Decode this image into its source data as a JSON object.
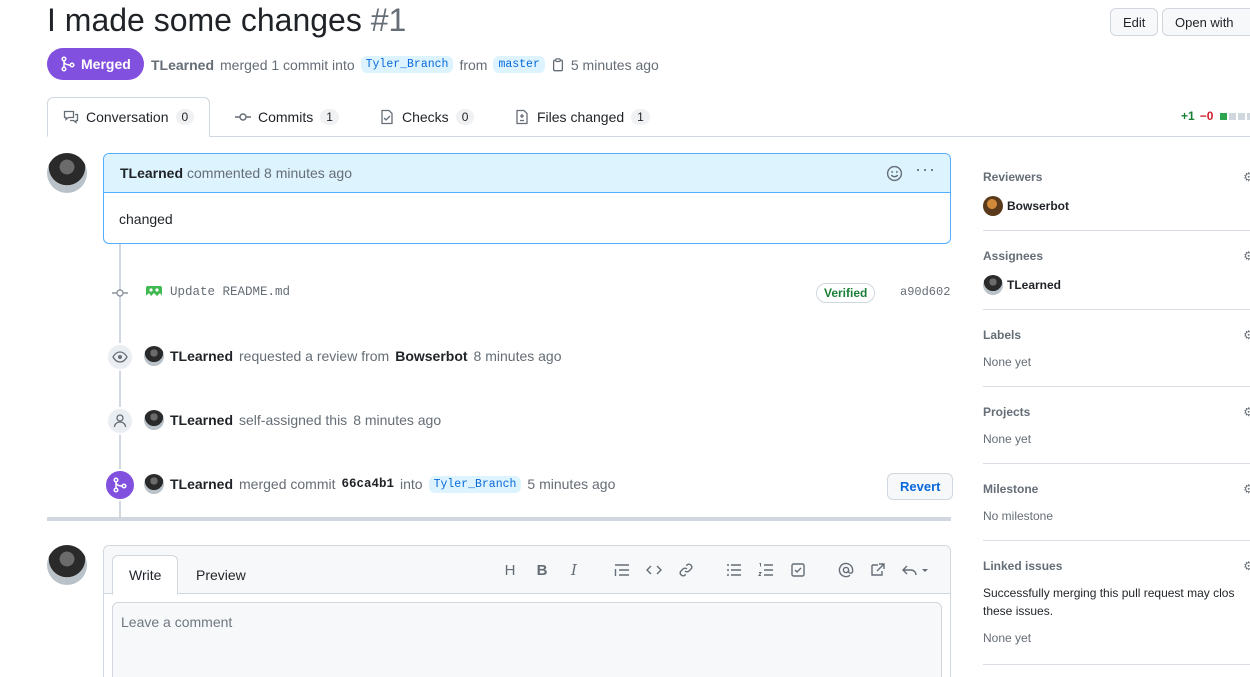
{
  "header": {
    "title": "I made some changes",
    "number": "#1",
    "edit_label": "Edit",
    "open_with_label": "Open with"
  },
  "state": {
    "label": "Merged",
    "author": "TLearned",
    "text_merged": "merged 1 commit into",
    "base_branch": "Tyler_Branch",
    "text_from": "from",
    "head_branch": "master",
    "time": "5 minutes ago"
  },
  "tabs": [
    {
      "label": "Conversation",
      "count": "0"
    },
    {
      "label": "Commits",
      "count": "1"
    },
    {
      "label": "Checks",
      "count": "0"
    },
    {
      "label": "Files changed",
      "count": "1"
    }
  ],
  "diffstat": {
    "additions": "+1",
    "deletions": "−0"
  },
  "comment": {
    "author": "TLearned",
    "meta": "commented 8 minutes ago",
    "body": "changed"
  },
  "timeline": {
    "commit_message": "Update README.md",
    "verified_label": "Verified",
    "commit_sha": "a90d602",
    "review_event": {
      "actor": "TLearned",
      "text": "requested a review from",
      "target": "Bowserbot",
      "time": "8 minutes ago"
    },
    "assign_event": {
      "actor": "TLearned",
      "text": "self-assigned this",
      "time": "8 minutes ago"
    },
    "merge_event": {
      "actor": "TLearned",
      "text": "merged commit",
      "sha": "66ca4b1",
      "text_into": "into",
      "branch": "Tyler_Branch",
      "time": "5 minutes ago",
      "revert_label": "Revert"
    }
  },
  "composer": {
    "write_tab": "Write",
    "preview_tab": "Preview",
    "placeholder": "Leave a comment",
    "tools": [
      "heading-icon",
      "bold-icon",
      "italic-icon",
      "quote-icon",
      "code-icon",
      "link-icon",
      "unordered-list-icon",
      "ordered-list-icon",
      "task-list-icon",
      "mention-icon",
      "cross-reference-icon",
      "reply-icon"
    ]
  },
  "sidebar": {
    "reviewers": {
      "title": "Reviewers",
      "user": "Bowserbot"
    },
    "assignees": {
      "title": "Assignees",
      "user": "TLearned"
    },
    "labels": {
      "title": "Labels",
      "value": "None yet"
    },
    "projects": {
      "title": "Projects",
      "value": "None yet"
    },
    "milestone": {
      "title": "Milestone",
      "value": "No milestone"
    },
    "linked_issues": {
      "title": "Linked issues",
      "line1": "Successfully merging this pull request may clos",
      "line2": "these issues.",
      "value": "None yet"
    }
  },
  "colors": {
    "merged_purple": "#8250df",
    "link_blue": "#0969da",
    "verified_green": "#1a7f37",
    "highlight_header": "#ddf4ff"
  }
}
